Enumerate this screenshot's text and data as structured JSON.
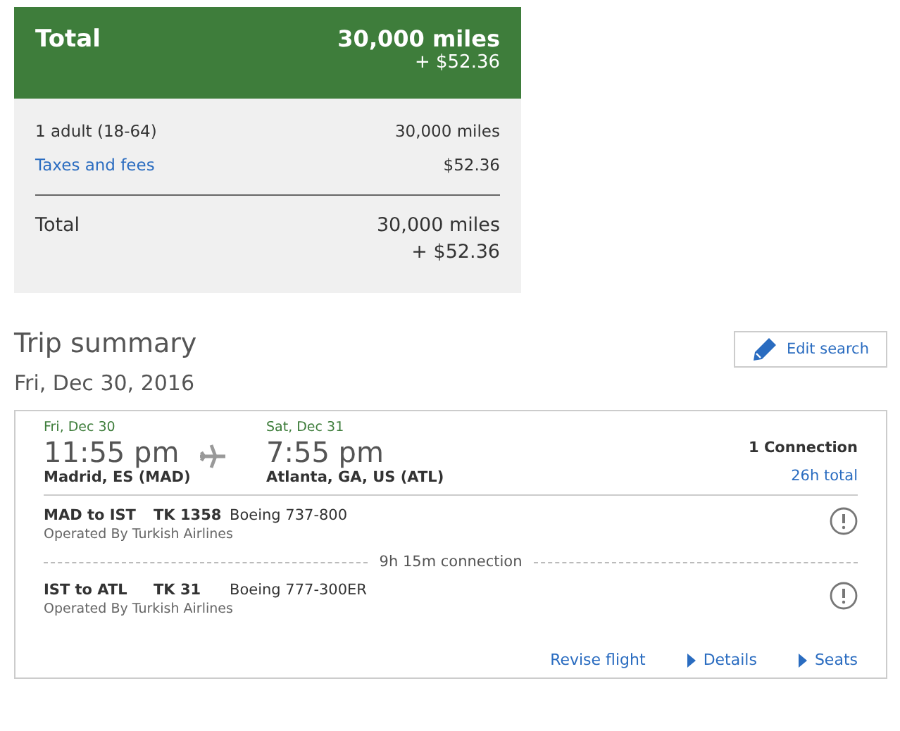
{
  "total_card": {
    "title": "Total",
    "miles": "30,000 miles",
    "fees": "+ $52.36",
    "lines": [
      {
        "label": "1 adult (18-64)",
        "value": "30,000 miles",
        "kind": "plain"
      },
      {
        "label": "Taxes and fees",
        "value": "$52.36",
        "kind": "link"
      }
    ],
    "total_label": "Total",
    "total_miles": "30,000 miles",
    "total_fees": "+ $52.36"
  },
  "trip": {
    "heading": "Trip summary",
    "date": "Fri, Dec 30, 2016",
    "edit_button": "Edit search"
  },
  "flight": {
    "depart_date": "Fri, Dec 30",
    "depart_time": "11:55 pm",
    "depart_city": "Madrid, ES (MAD)",
    "arrive_date": "Sat, Dec 31",
    "arrive_time": "7:55 pm",
    "arrive_city": "Atlanta, GA, US (ATL)",
    "connections": "1 Connection",
    "duration": "26h total",
    "segments": [
      {
        "route": "MAD to IST",
        "flight": "TK 1358",
        "aircraft": "Boeing 737-800",
        "operator": "Operated By Turkish Airlines"
      },
      {
        "route": "IST to ATL",
        "flight": "TK 31",
        "aircraft": "Boeing 777-300ER",
        "operator": "Operated By Turkish Airlines"
      }
    ],
    "layovers": [
      "9h 15m connection"
    ],
    "links": [
      {
        "label": "Revise flight",
        "kind": "plain"
      },
      {
        "label": "Details",
        "kind": "caret"
      },
      {
        "label": "Seats",
        "kind": "caret"
      }
    ]
  }
}
